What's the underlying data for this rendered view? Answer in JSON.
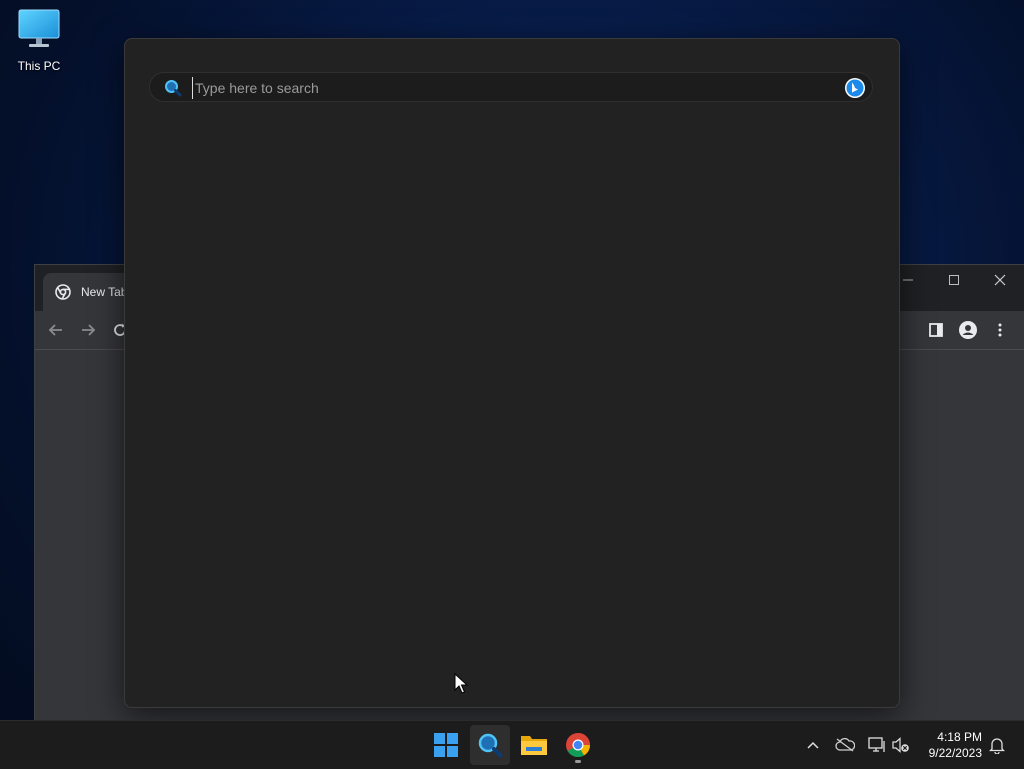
{
  "desktop": {
    "icons": [
      {
        "label": "This PC",
        "icon": "monitor-icon"
      }
    ]
  },
  "chrome": {
    "tab_title": "New Tab",
    "tab_icon": "chrome-icon"
  },
  "search": {
    "placeholder": "Type here to search",
    "value": ""
  },
  "taskbar": {
    "apps": [
      "start-icon",
      "search-icon",
      "file-explorer-icon",
      "chrome-icon"
    ]
  },
  "tray": {
    "time": "4:18 PM",
    "date": "9/22/2023"
  },
  "colors": {
    "accent": "#0078d4",
    "panel": "#222222",
    "taskbar": "#1c1c1c"
  }
}
